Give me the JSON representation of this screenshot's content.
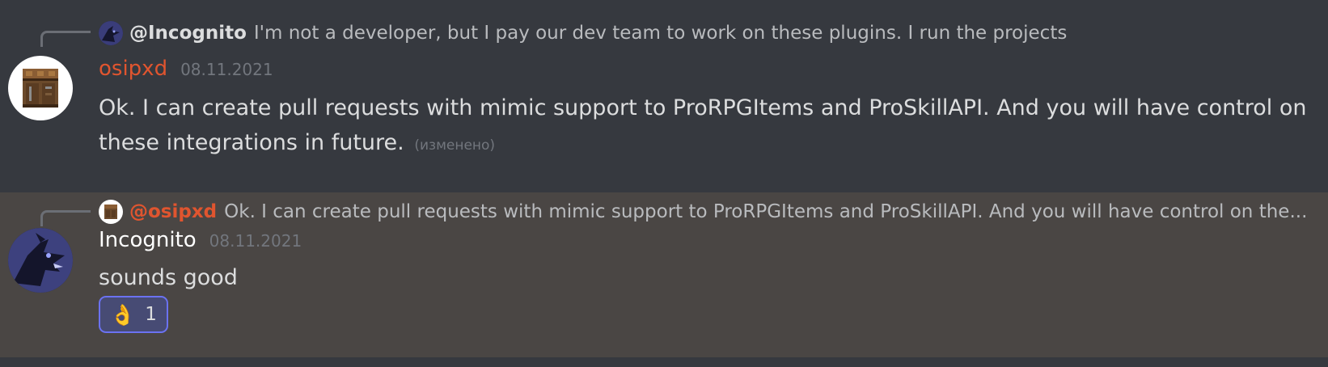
{
  "colors": {
    "background": "#36393f",
    "highlight_background": "#4a4644",
    "osipxd_name": "#e0552f",
    "incognito_name": "#ffffff",
    "reaction_border": "#6b72f2"
  },
  "messages": [
    {
      "reply": {
        "author": "@Incognito",
        "text": "I'm not  a developer, but I pay our dev team to work on these plugins. I run the projects",
        "avatar_icon": "dark-dragon-avatar-icon"
      },
      "author": "osipxd",
      "timestamp": "08.11.2021",
      "avatar_icon": "crafting-table-avatar-icon",
      "content": "Ok. I can create pull requests with mimic support to ProRPGItems and ProSkillAPI. And you will have control on these integrations in future.",
      "edited_label": "(изменено)"
    },
    {
      "reply": {
        "author": "@osipxd",
        "text": "Ok. I can create pull requests with mimic support to ProRPGItems and ProSkillAPI. And you will have control on the...",
        "avatar_icon": "crafting-table-avatar-icon"
      },
      "author": "Incognito",
      "timestamp": "08.11.2021",
      "avatar_icon": "dark-dragon-avatar-icon",
      "content": "sounds good",
      "reaction": {
        "emoji": "👌",
        "emoji_icon": "ok-hand-emoji-icon",
        "count": "1"
      }
    }
  ]
}
